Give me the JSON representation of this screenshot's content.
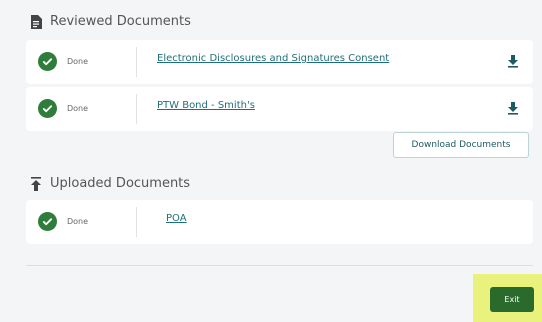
{
  "reviewed": {
    "heading": "Reviewed Documents",
    "items": [
      {
        "status": "Done",
        "title": "Electronic Disclosures and Signatures Consent"
      },
      {
        "status": "Done",
        "title": "PTW Bond - Smith's"
      }
    ],
    "download_all_label": "Download Documents"
  },
  "uploaded": {
    "heading": "Uploaded Documents",
    "items": [
      {
        "status": "Done",
        "title": "POA"
      }
    ]
  },
  "footer": {
    "exit_label": "Exit"
  },
  "colors": {
    "status_green": "#2f7d3a",
    "link": "#1f6f7a",
    "exit_button": "#2a6a2c",
    "highlight": "#e8f27c"
  }
}
